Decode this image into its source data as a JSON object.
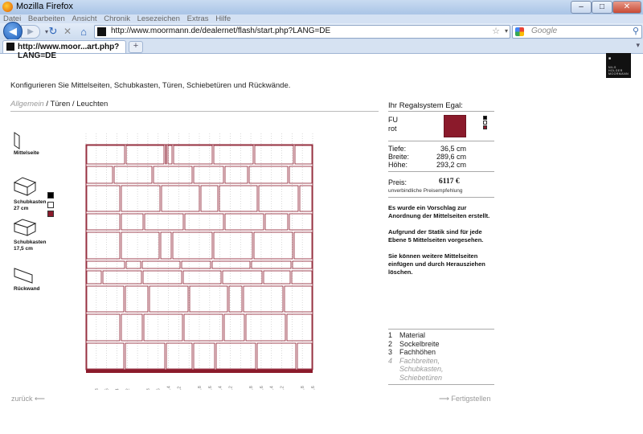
{
  "window": {
    "title": "Mozilla Firefox",
    "minimize": "–",
    "maximize": "□",
    "close": "✕"
  },
  "menu": [
    "Datei",
    "Bearbeiten",
    "Ansicht",
    "Chronik",
    "Lesezeichen",
    "Extras",
    "Hilfe"
  ],
  "nav": {
    "back_icon": "back-arrow-icon",
    "forward_icon": "forward-arrow-icon",
    "url": "http://www.moormann.de/dealernet/flash/start.php?LANG=DE",
    "search_placeholder": "Google"
  },
  "tabs": [
    {
      "label": "http://www.moor...art.php?LANG=DE"
    }
  ],
  "page": {
    "instruction": "Konfigurieren Sie Mittelseiten, Schubkasten, Türen, Schiebetüren und Rückwände.",
    "breadcrumb": {
      "inactive": "Allgemein",
      "sep1": " / ",
      "active1": "Türen",
      "sep2": " / ",
      "active2": "Leuchten"
    },
    "tools": {
      "mittelseite": "Mittelseite",
      "schubkasten27": "Schubkasten",
      "schubkasten27_size": "27 cm",
      "schubkasten17": "Schubkasten",
      "schubkasten17_size": "17,5 cm",
      "rueckwand": "Rückwand"
    },
    "swatches": [
      "#000000",
      "#ffffff",
      "#8b1a2b"
    ],
    "ruler_ticks": [
      "0",
      "12,8",
      "25,6",
      "38,4",
      "51,2",
      "64",
      "76,8",
      "89,6",
      "102,4",
      "115,2",
      "128",
      "140,8",
      "153,6",
      "166,4",
      "179,2",
      "192",
      "204,8",
      "217,6",
      "230,4",
      "243,2",
      "256",
      "268,8",
      "281,6"
    ],
    "shelf_color": "#8b1a2b"
  },
  "summary": {
    "title": "Ihr Regalsystem Egal:",
    "material_code": "FU",
    "material_color": "rot",
    "tiefe_label": "Tiefe:",
    "tiefe_value": "36,5 cm",
    "breite_label": "Breite:",
    "breite_value": "289,6 cm",
    "hoehe_label": "Höhe:",
    "hoehe_value": "293,2 cm",
    "preis_label": "Preis:",
    "preis_value": "6117 €",
    "preis_note": "unverbindliche Preisempfehlung",
    "note1": "Es wurde ein Vorschlag zur Anordnung der Mittelseiten erstellt.",
    "note2": "Aufgrund der Statik sind für jede Ebene 5 Mittelseiten vorgesehen.",
    "note3": "Sie können weitere Mittelseiten einfügen und durch Herausziehen löschen."
  },
  "steps": [
    {
      "num": "1",
      "label": "Material"
    },
    {
      "num": "2",
      "label": "Sockelbreite"
    },
    {
      "num": "3",
      "label": "Fachhöhen"
    },
    {
      "num": "4",
      "label": "Fachbreiten, Schubkasten, Schiebetüren"
    }
  ],
  "footer": {
    "back": "zurück",
    "next": "Fertigstellen"
  }
}
